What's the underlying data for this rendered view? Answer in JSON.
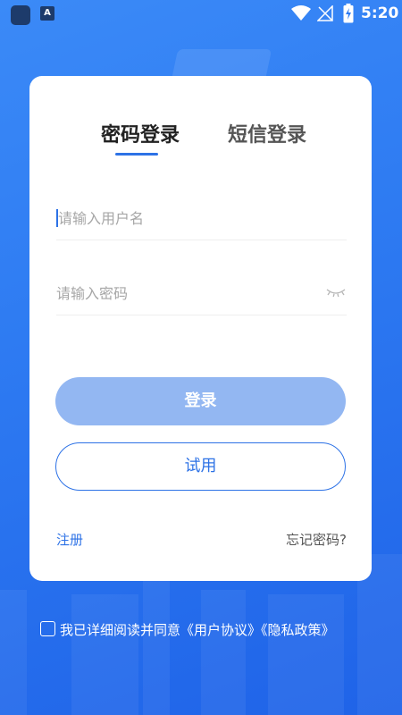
{
  "status_bar": {
    "app_badge": "A",
    "time": "5:20"
  },
  "login": {
    "tabs": [
      {
        "label": "密码登录",
        "active": true
      },
      {
        "label": "短信登录",
        "active": false
      }
    ],
    "username": {
      "value": "",
      "placeholder": "请输入用户名"
    },
    "password": {
      "value": "",
      "placeholder": "请输入密码"
    },
    "login_button": "登录",
    "trial_button": "试用",
    "register_link": "注册",
    "forgot_link": "忘记密码?"
  },
  "agreement": {
    "checked": false,
    "text": "我已详细阅读并同意",
    "user_agreement": "《用户协议》",
    "privacy_policy": "《隐私政策》"
  },
  "colors": {
    "accent": "#2d72e6",
    "button_disabled": "#93b7f2",
    "background": "#2e7bf2"
  },
  "icons": [
    "wifi-icon",
    "signal-off-icon",
    "battery-charging-icon",
    "eye-closed-icon",
    "checkbox-icon"
  ]
}
